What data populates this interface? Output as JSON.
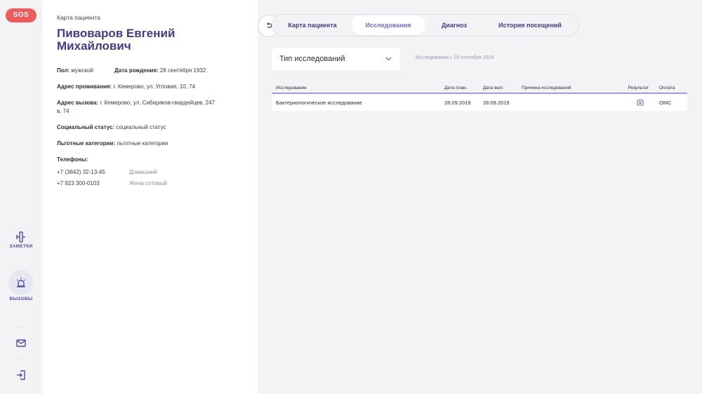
{
  "rail": {
    "sos_label": "SOS",
    "notes_label": "ЗАМЕТКИ",
    "calls_label": "ВЫЗОВЫ",
    "dots": "...",
    "icons": [
      "notes-icon",
      "alarm-icon",
      "mail-icon",
      "logout-icon"
    ]
  },
  "card": {
    "header": "Карта пациента",
    "name": "Пивоваров Евгений Михайлович",
    "gender_label": "Пол:",
    "gender": "мужской",
    "dob_label": "Дата рождения:",
    "dob": "28 сентября 1932",
    "residence_label": "Адрес проживания:",
    "residence": "г. Кемерово, ул. Угловая, 10, 74",
    "call_address_label": "Адрес вызова:",
    "call_address": "г. Кемерово, ул. Сибиряков-гвардейцев, 247 в, 74",
    "social_label": "Социальный статус:",
    "social": "социальный статус",
    "benefits_label": "Льготные категории:",
    "benefits": "льготные категории",
    "phones_label": "Телефоны:",
    "phones": [
      {
        "number": "+7 (3842) 32-13-45",
        "type": "Домашний"
      },
      {
        "number": "+7 923 300-0103",
        "type": "Жена сотовый"
      }
    ]
  },
  "tabs": [
    {
      "label": "Карта пациента",
      "active": false
    },
    {
      "label": "Исследования",
      "active": true
    },
    {
      "label": "Диагноз",
      "active": false
    },
    {
      "label": "История посещений",
      "active": false
    }
  ],
  "filter": {
    "select_value": "Тип исследований",
    "since_text": "Исследования с 28 сентября 2019"
  },
  "table": {
    "headers": [
      "Исследование",
      "Дата план.",
      "Дата вып.",
      "Причина исследований",
      "Результат",
      "Оплата"
    ],
    "rows": [
      {
        "study": "Бактериологическое исследование",
        "planned": "28.09.2019",
        "done": "28.09.2019",
        "reason": "",
        "result_icon": "document-icon",
        "payment": "ОМС"
      }
    ]
  },
  "colors": {
    "accent": "#3e3d86",
    "active_tab": "#6d6bd6",
    "sos": "#ef5a5a",
    "table_rule": "#9f9ee4"
  }
}
